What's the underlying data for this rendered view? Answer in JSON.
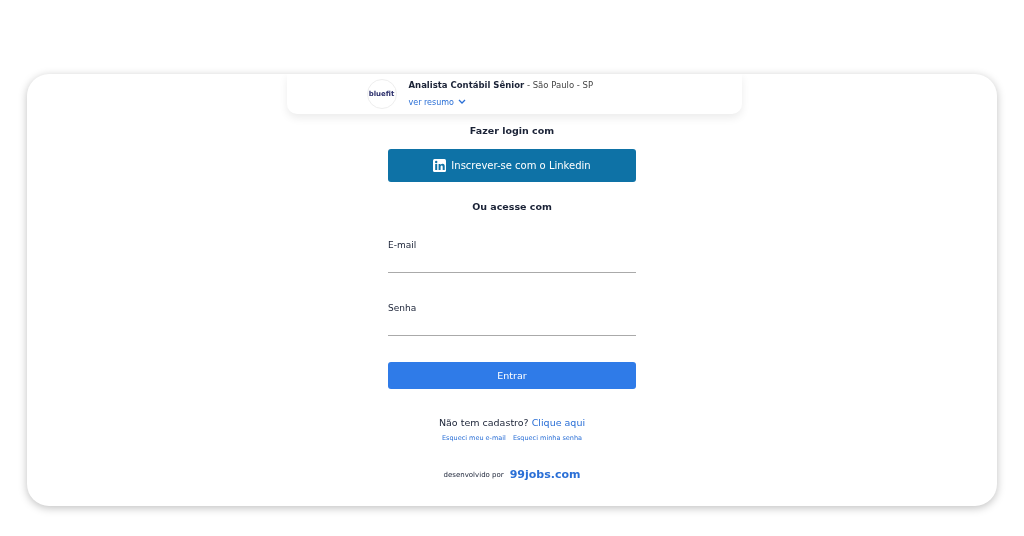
{
  "job": {
    "logo": "bluefit",
    "title": "Analista Contábil Sênior",
    "location": " - São Paulo - SP",
    "summary_link": "ver resumo"
  },
  "login_heading": "Fazer login com",
  "linkedin_button": "Inscrever-se com o Linkedin",
  "alt_heading": "Ou acesse com",
  "fields": [
    {
      "label": "E-mail"
    },
    {
      "label": "Senha"
    }
  ],
  "submit_button": "Entrar",
  "signup": {
    "text": "Não tem cadastro?",
    "link": "Clique aqui"
  },
  "help_links": [
    "Esqueci meu e-mail",
    "Esqueci minha senha"
  ],
  "footer": {
    "text": "desenvolvido por",
    "brand": "99jobs.com"
  }
}
